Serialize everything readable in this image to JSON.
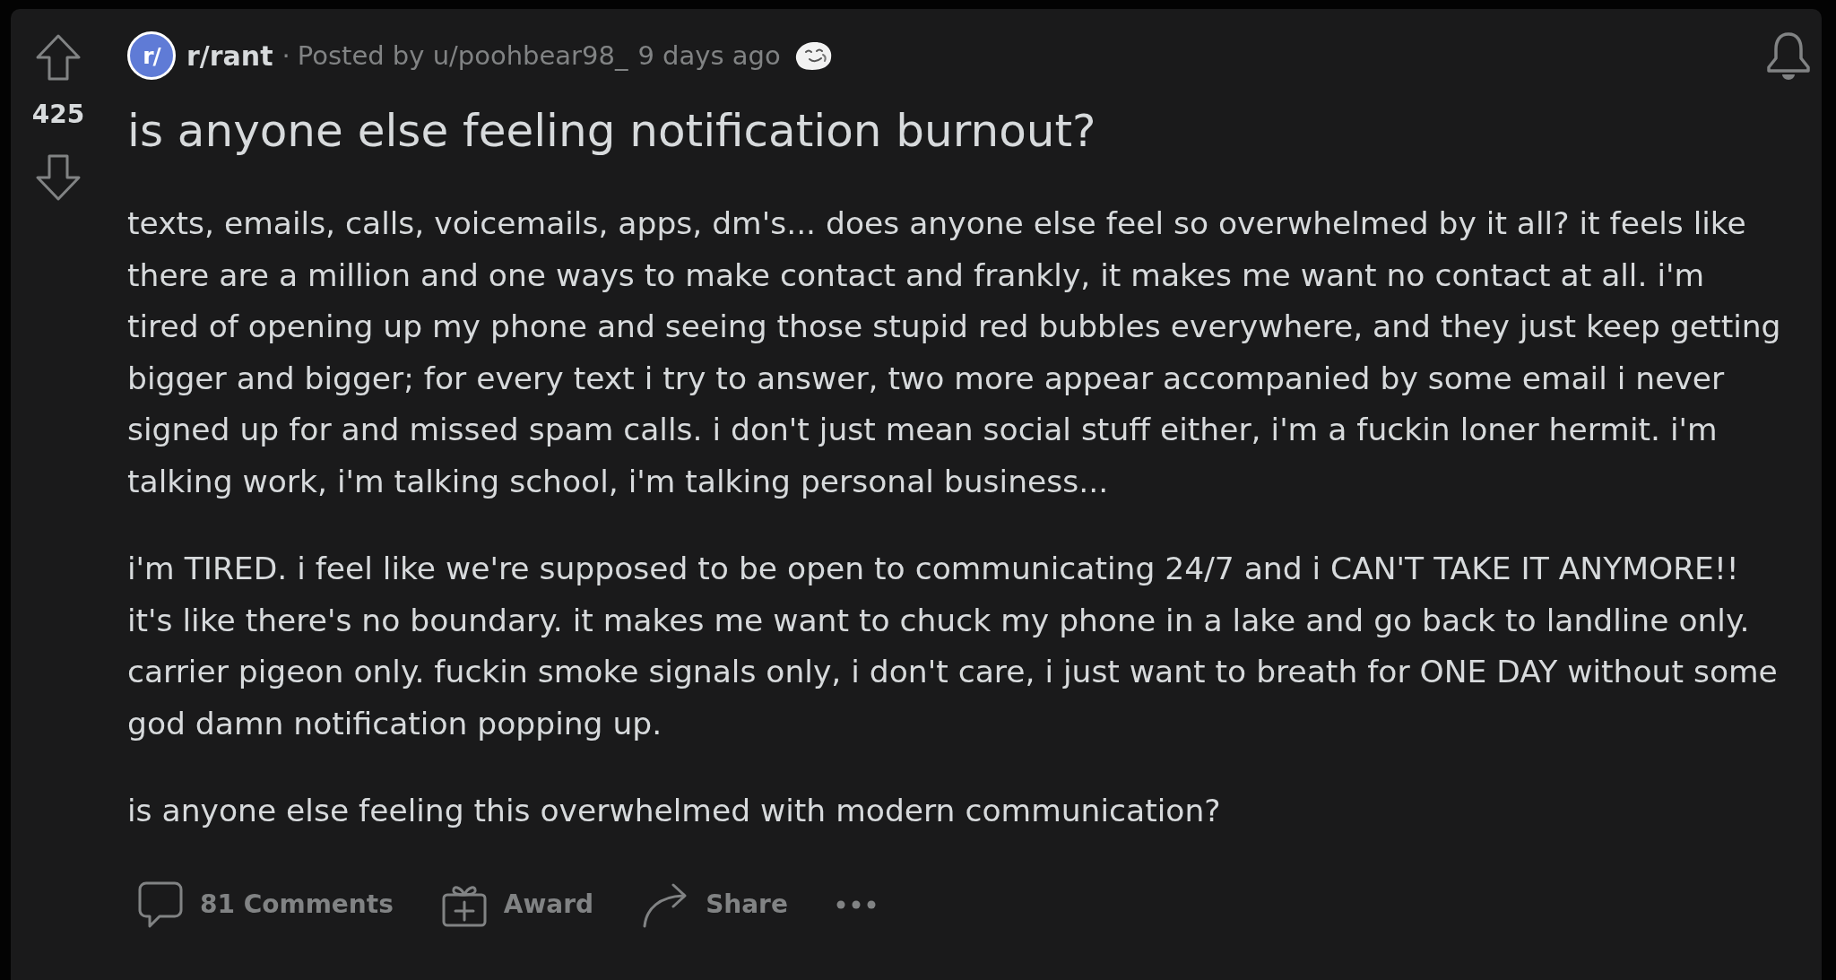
{
  "post": {
    "votes": {
      "count": "425"
    },
    "header": {
      "subreddit_icon": "r/",
      "subreddit": "r/rant",
      "separator": "·",
      "posted_by": "Posted by u/poohbear98_",
      "time": "9 days ago"
    },
    "title": "is anyone else feeling notification burnout?",
    "paragraphs": [
      "texts, emails, calls, voicemails, apps, dm's... does anyone else feel so overwhelmed by it all? it feels like there are a million and one ways to make contact and frankly, it makes me want no contact at all. i'm tired of opening up my phone and seeing those stupid red bubbles everywhere, and they just keep getting bigger and bigger; for every text i try to answer, two more appear accompanied by some email i never signed up for and missed spam calls. i don't just mean social stuff either, i'm a fuckin loner hermit. i'm talking work, i'm talking school, i'm talking personal business...",
      "i'm TIRED. i feel like we're supposed to be open to communicating 24/7 and i CAN'T TAKE IT ANYMORE!! it's like there's no boundary. it makes me want to chuck my phone in a lake and go back to landline only. carrier pigeon only. fuckin smoke signals only, i don't care, i just want to breath for ONE DAY without some god damn notification popping up.",
      "is anyone else feeling this overwhelmed with modern communication?"
    ],
    "actions": [
      {
        "kind": "comments",
        "label": "81 Comments"
      },
      {
        "kind": "award",
        "label": "Award"
      },
      {
        "kind": "share",
        "label": "Share"
      },
      {
        "kind": "more"
      }
    ]
  }
}
